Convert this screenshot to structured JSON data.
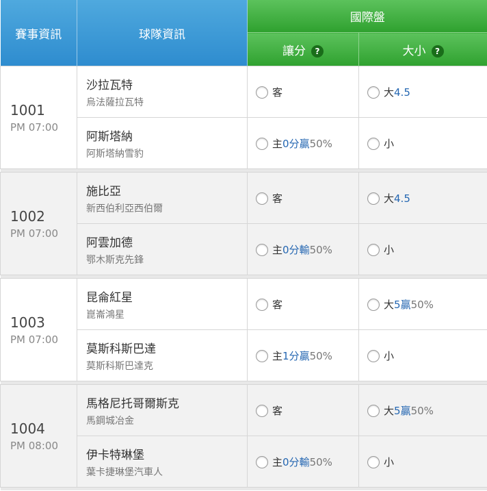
{
  "header": {
    "match_info": "賽事資訊",
    "team_info": "球隊資訊",
    "intl": "國際盤",
    "handicap": "讓分",
    "overunder": "大小",
    "help_glyph": "?"
  },
  "matches": [
    {
      "no": "1001",
      "time": "PM 07:00",
      "teams": [
        {
          "name": "沙拉瓦特",
          "sub": "烏法薩拉瓦特",
          "hcp": {
            "label": "客",
            "val": "",
            "res": "",
            "pct": ""
          },
          "ou": {
            "label": "大",
            "val": "4.5",
            "res": "",
            "pct": ""
          }
        },
        {
          "name": "阿斯塔納",
          "sub": "阿斯塔納雪豹",
          "hcp": {
            "label": "主",
            "val": "0分",
            "res": "贏",
            "pct": "50%"
          },
          "ou": {
            "label": "小",
            "val": "",
            "res": "",
            "pct": ""
          }
        }
      ]
    },
    {
      "no": "1002",
      "time": "PM 07:00",
      "teams": [
        {
          "name": "施比亞",
          "sub": "新西伯利亞西伯爾",
          "hcp": {
            "label": "客",
            "val": "",
            "res": "",
            "pct": ""
          },
          "ou": {
            "label": "大",
            "val": "4.5",
            "res": "",
            "pct": ""
          }
        },
        {
          "name": "阿雲加德",
          "sub": "鄂木斯克先鋒",
          "hcp": {
            "label": "主",
            "val": "0分",
            "res": "輸",
            "pct": "50%"
          },
          "ou": {
            "label": "小",
            "val": "",
            "res": "",
            "pct": ""
          }
        }
      ]
    },
    {
      "no": "1003",
      "time": "PM 07:00",
      "teams": [
        {
          "name": "昆侖紅星",
          "sub": "崑崙鴻星",
          "hcp": {
            "label": "客",
            "val": "",
            "res": "",
            "pct": ""
          },
          "ou": {
            "label": "大",
            "val": "5",
            "res": "贏",
            "pct": "50%"
          }
        },
        {
          "name": "莫斯科斯巴達",
          "sub": "莫斯科斯巴達克",
          "hcp": {
            "label": "主",
            "val": "1分",
            "res": "贏",
            "pct": "50%"
          },
          "ou": {
            "label": "小",
            "val": "",
            "res": "",
            "pct": ""
          }
        }
      ]
    },
    {
      "no": "1004",
      "time": "PM 08:00",
      "teams": [
        {
          "name": "馬格尼托哥爾斯克",
          "sub": "馬鋼城冶金",
          "hcp": {
            "label": "客",
            "val": "",
            "res": "",
            "pct": ""
          },
          "ou": {
            "label": "大",
            "val": "5",
            "res": "贏",
            "pct": "50%"
          }
        },
        {
          "name": "伊卡特琳堡",
          "sub": "葉卡捷琳堡汽車人",
          "hcp": {
            "label": "主",
            "val": "0分",
            "res": "輸",
            "pct": "50%"
          },
          "ou": {
            "label": "小",
            "val": "",
            "res": "",
            "pct": ""
          }
        }
      ]
    }
  ]
}
